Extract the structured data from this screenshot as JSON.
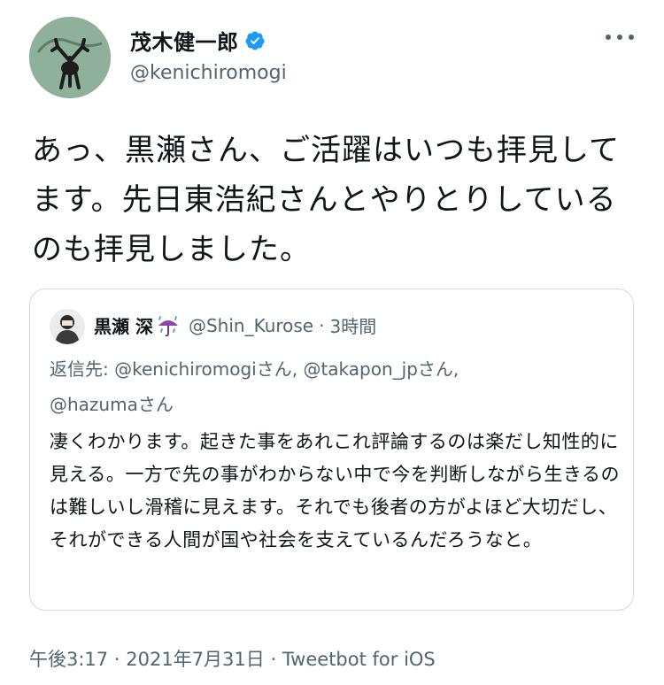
{
  "author": {
    "display_name": "茂木健一郎",
    "handle": "@kenichiromogi",
    "verified": true
  },
  "tweet": {
    "text": "あっ、黒瀬さん、ご活躍はいつも拝見してます。先日東浩紀さんとやりとりしているのも拝見しました。",
    "time": "午後3:17",
    "date": "2021年7月31日",
    "source": "Tweetbot for iOS",
    "separator": "·"
  },
  "quoted": {
    "display_name": "黒瀬 深",
    "emoji": "umbrella-with-rain",
    "handle": "@Shin_Kurose",
    "separator": "·",
    "relative_time": "3時間",
    "reply_label": "返信先:",
    "reply_to": [
      {
        "handle": "@kenichiromogi",
        "suffix": "さん,"
      },
      {
        "handle": "@takapon_jp",
        "suffix": "さん,"
      },
      {
        "handle": "@hazuma",
        "suffix": "さん"
      }
    ],
    "text": "凄くわかります。起きた事をあれこれ評論するのは楽だし知性的に見える。一方で先の事がわからない中で今を判断しながら生きるのは難しいし滑稽に見えます。それでも後者の方がよほど大切だし、それができる人間が国や社会を支えているんだろうなと。"
  },
  "icons": {
    "more": "more-dots-icon",
    "verified": "verified-badge-icon",
    "umbrella": "umbrella-rain-icon"
  },
  "colors": {
    "text": "#0f1419",
    "secondary": "#536471",
    "verified": "#1d9bf0",
    "border": "#cfd9de"
  }
}
